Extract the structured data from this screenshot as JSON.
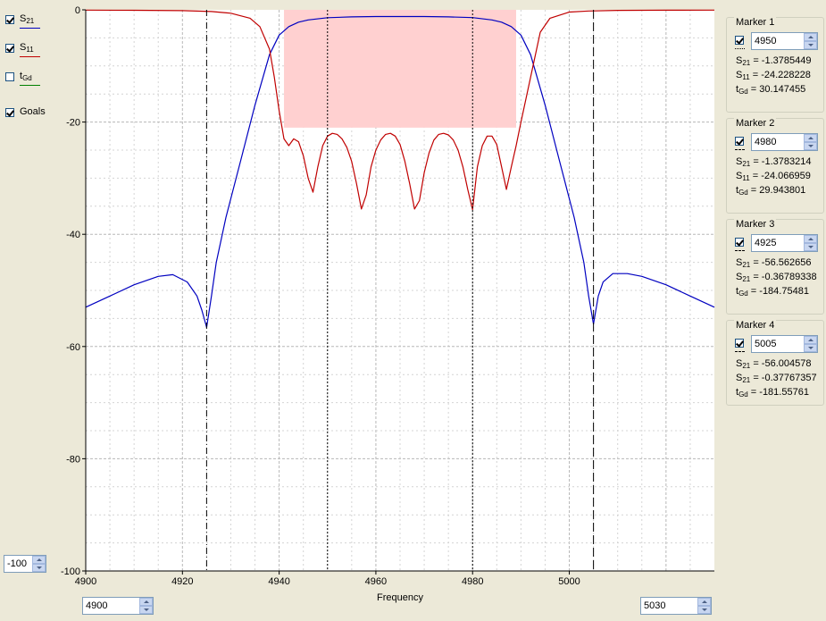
{
  "legend": {
    "s21": {
      "label": "S",
      "sub": "21",
      "checked": true,
      "color": "#0000c0"
    },
    "s11": {
      "label": "S",
      "sub": "11",
      "checked": true,
      "color": "#c00000"
    },
    "tgd": {
      "label": "t",
      "sub": "Gd",
      "checked": false,
      "color": "#008000"
    },
    "goals": {
      "label": "Goals",
      "checked": true
    }
  },
  "controls": {
    "y_min_value": "-100",
    "x_min_value": "4900",
    "x_max_value": "5030"
  },
  "markers": [
    {
      "title": "Marker 1",
      "freq": "4950",
      "line_style": "dotted",
      "lines": [
        {
          "label": "S",
          "sub": "21",
          "value": "= -1.3785449"
        },
        {
          "label": "S",
          "sub": "11",
          "value": "= -24.228228"
        },
        {
          "label": "t",
          "sub": "Gd",
          "value": "= 30.147455"
        }
      ]
    },
    {
      "title": "Marker 2",
      "freq": "4980",
      "line_style": "dashed",
      "lines": [
        {
          "label": "S",
          "sub": "21",
          "value": "= -1.3783214"
        },
        {
          "label": "S",
          "sub": "11",
          "value": "= -24.066959"
        },
        {
          "label": "t",
          "sub": "Gd",
          "value": "= 29.943801"
        }
      ]
    },
    {
      "title": "Marker 3",
      "freq": "4925",
      "line_style": "dash-dot",
      "lines": [
        {
          "label": "S",
          "sub": "21",
          "value": "= -56.562656"
        },
        {
          "label": "S",
          "sub": "21",
          "value": "= -0.36789338"
        },
        {
          "label": "t",
          "sub": "Gd",
          "value": "= -184.75481"
        }
      ]
    },
    {
      "title": "Marker 4",
      "freq": "5005",
      "line_style": "long-dash",
      "lines": [
        {
          "label": "S",
          "sub": "21",
          "value": "= -56.004578"
        },
        {
          "label": "S",
          "sub": "21",
          "value": "= -0.37767357"
        },
        {
          "label": "t",
          "sub": "Gd",
          "value": "= -181.55761"
        }
      ]
    }
  ],
  "chart_data": {
    "type": "line",
    "xlabel": "Frequency",
    "ylabel": "",
    "xlim": [
      4900,
      5030
    ],
    "ylim": [
      -100,
      0
    ],
    "xticks": [
      "4900",
      "4920",
      "4940",
      "4960",
      "4980",
      "5000"
    ],
    "yticks": [
      "0",
      "-20",
      "-40",
      "-60",
      "-80",
      "-100"
    ],
    "grid": true,
    "goal_region": {
      "x": [
        4941,
        4989
      ],
      "y": [
        -21,
        0
      ],
      "color": "#ffd0d0"
    },
    "marker_lines": [
      {
        "x": 4925,
        "style": "dash-dot"
      },
      {
        "x": 4950,
        "style": "dotted"
      },
      {
        "x": 4980,
        "style": "dotted"
      },
      {
        "x": 5005,
        "style": "long-dash"
      }
    ],
    "series": [
      {
        "name": "S21",
        "color": "#0000c0",
        "x": [
          4900,
          4905,
          4910,
          4915,
          4918,
          4921,
          4923,
          4924,
          4925,
          4926,
          4927,
          4929,
          4932,
          4935,
          4938,
          4940,
          4942,
          4944,
          4946,
          4950,
          4955,
          4960,
          4965,
          4970,
          4975,
          4980,
          4984,
          4986,
          4988,
          4990,
          4992,
          4995,
          4998,
          5001,
          5003,
          5004,
          5005,
          5006,
          5007,
          5009,
          5012,
          5015,
          5020,
          5025,
          5030
        ],
        "y": [
          -53,
          -51,
          -49,
          -47.5,
          -47.2,
          -48.5,
          -51,
          -53.5,
          -56.6,
          -51,
          -45,
          -37,
          -27,
          -17,
          -8,
          -4.5,
          -3,
          -2.2,
          -1.8,
          -1.4,
          -1.25,
          -1.2,
          -1.2,
          -1.2,
          -1.25,
          -1.38,
          -1.8,
          -2.2,
          -3,
          -4.5,
          -8,
          -17,
          -27,
          -37,
          -45,
          -51,
          -56,
          -51,
          -48.5,
          -47,
          -47,
          -47.5,
          -49,
          -51,
          -53
        ]
      },
      {
        "name": "S11",
        "color": "#c00000",
        "x": [
          4900,
          4910,
          4920,
          4926,
          4930,
          4934,
          4936,
          4938,
          4939,
          4940,
          4941,
          4942,
          4943,
          4944,
          4945,
          4946,
          4947,
          4948,
          4949,
          4950,
          4951,
          4952,
          4953,
          4954,
          4955,
          4956,
          4957,
          4958,
          4959,
          4960,
          4961,
          4962,
          4963,
          4964,
          4965,
          4966,
          4967,
          4968,
          4969,
          4970,
          4971,
          4972,
          4973,
          4974,
          4975,
          4976,
          4977,
          4978,
          4979,
          4980,
          4981,
          4982,
          4983,
          4984,
          4985,
          4986,
          4987,
          4988,
          4989,
          4990,
          4992,
          4994,
          4996,
          5000,
          5004,
          5010,
          5020,
          5030
        ],
        "y": [
          -0.05,
          -0.08,
          -0.15,
          -0.3,
          -0.6,
          -1.5,
          -3,
          -7,
          -12,
          -18,
          -23,
          -24.2,
          -23,
          -23.5,
          -26,
          -30,
          -32.5,
          -28,
          -24.2,
          -22.5,
          -22,
          -22.2,
          -23,
          -24.5,
          -27,
          -31,
          -35.5,
          -33,
          -28,
          -25,
          -23.2,
          -22.2,
          -22,
          -22.5,
          -24,
          -27,
          -31,
          -35.5,
          -34,
          -29,
          -25.5,
          -23.2,
          -22.2,
          -22,
          -22.3,
          -23.2,
          -25,
          -28,
          -32,
          -35.6,
          -28,
          -24.2,
          -22.5,
          -22.5,
          -24,
          -28,
          -32,
          -28,
          -24.2,
          -20,
          -12,
          -4,
          -1.5,
          -0.4,
          -0.2,
          -0.1,
          -0.06,
          -0.05
        ]
      }
    ]
  }
}
